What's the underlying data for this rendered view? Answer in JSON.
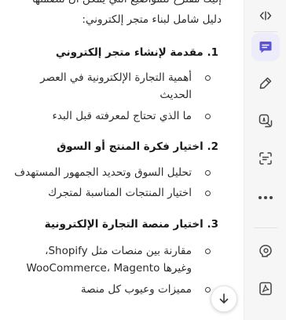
{
  "intro": {
    "line1": "إليك مقترح للمواضيع التي يمكن أن تتضمنها",
    "line2": "دليل شامل لبناء متجر إلكتروني:"
  },
  "sections": [
    {
      "heading": "1. مقدمة لإنشاء متجر إلكتروني",
      "items": [
        "أهمية التجارة الإلكترونية في العصر",
        "الحديث",
        "ما الذي تحتاج لمعرفته قبل البدء"
      ]
    },
    {
      "heading": "2. اختيار فكرة المنتج أو السوق",
      "items": [
        "تحليل السوق وتحديد الجمهور المستهدف",
        "اختيار المنتجات المناسبة لمتجرك"
      ]
    },
    {
      "heading": "3. اختيار منصة التجارة الإلكترونية",
      "items": [
        "مقارنة بين منصات مثل Shopify،",
        "WooCommerce، Magento وغيرها",
        "مميزات وعيوب كل منصة"
      ]
    }
  ],
  "sidebar": {
    "collapse_icon": "collapse-expand-icon",
    "items": [
      {
        "icon": "chat-icon",
        "active": true
      },
      {
        "icon": "pen-icon",
        "active": false
      },
      {
        "icon": "translate-icon",
        "active": false
      },
      {
        "icon": "scan-icon",
        "active": false
      },
      {
        "icon": "more-icon",
        "active": false
      },
      {
        "icon": "brain-icon",
        "active": false
      },
      {
        "icon": "pdf-icon",
        "active": false
      }
    ]
  },
  "colors": {
    "accent": "#5b53d6",
    "active_bg": "#ececfb",
    "sidebar_bg": "#f6f6f7"
  }
}
